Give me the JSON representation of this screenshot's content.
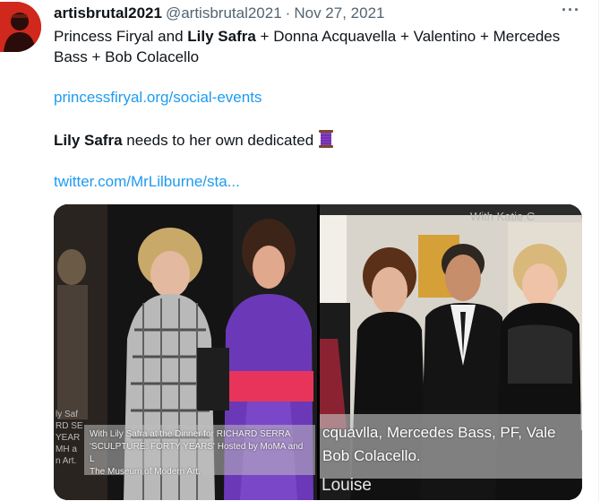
{
  "tweet": {
    "display_name": "artisbrutal2021",
    "handle": "@artisbrutal2021",
    "separator": "·",
    "date": "Nov 27, 2021",
    "more_glyph": "···",
    "line1": {
      "part1": "Princess Firyal and ",
      "bold1": "Lily Safra",
      "part2": " + Donna Acquavella + Valentino + Mercedes Bass + Bob Colacello"
    },
    "link1": "princessfiryal.org/social-events",
    "line2": {
      "bold": "Lily Safra",
      "rest": " needs to her own dedicated"
    },
    "link2": "twitter.com/MrLilburne/sta..."
  },
  "media": {
    "left_caption": "With Lily Safra at the Dinner for RICHARD SERRA\n'SCULPTURE: FORTY YEARS' Hosted by MoMA and L\nThe Museum of Modern Art.",
    "left_fragment": "ly Saf\nRD SE\nYEAR\nMH a\nn Art.",
    "right_caption": "cquavlla, Mercedes Bass, PF, Vale\nBob Colacello.",
    "right_fragment": "Louise",
    "right_top_fragment": "With Katie C"
  },
  "icons": {
    "avatar": "avatar",
    "more": "more-icon",
    "thread": "thread-spool-icon"
  },
  "colors": {
    "link": "#1d9bf0",
    "secondary": "#536471",
    "avatar_bg": "#d0281c",
    "dress_purple": "#6b39b8",
    "sash_pink": "#e8345a"
  }
}
